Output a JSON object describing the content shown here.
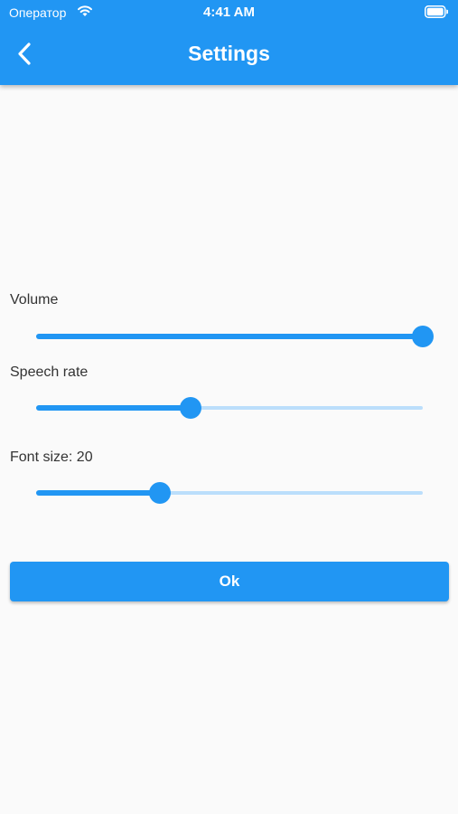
{
  "status_bar": {
    "carrier": "Оператор",
    "time": "4:41 AM",
    "icons": [
      "wifi-icon",
      "battery-icon"
    ]
  },
  "app_bar": {
    "title": "Settings",
    "back_icon": "chevron-left-icon",
    "color": "#2196f3"
  },
  "settings": {
    "volume": {
      "label": "Volume",
      "value": 1.0
    },
    "speech_rate": {
      "label": "Speech rate",
      "value": 0.4
    },
    "font_size": {
      "label": "Font size: 20",
      "value": 0.32
    }
  },
  "ok_button": {
    "label": "Ok"
  },
  "colors": {
    "accent": "#2196f3",
    "track_inactive": "#bbdefb",
    "background": "#fafafa"
  }
}
